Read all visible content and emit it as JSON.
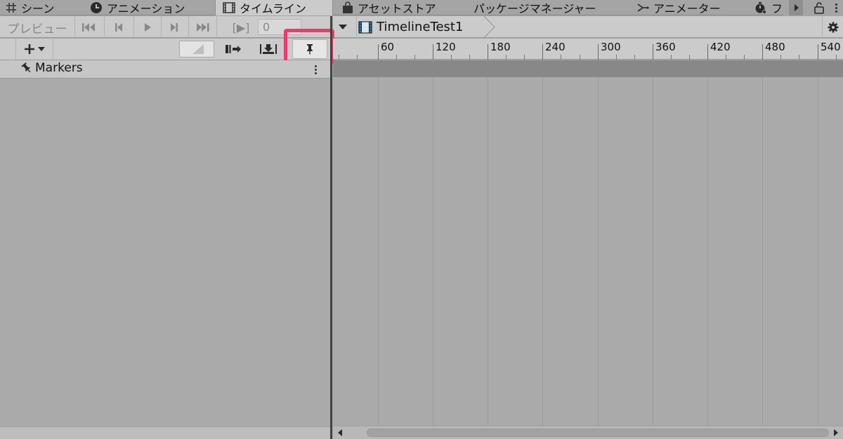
{
  "tabs": [
    {
      "label": "シーン",
      "icon": "grid-icon"
    },
    {
      "label": "アニメーション",
      "icon": "clock-icon"
    },
    {
      "label": "タイムライン",
      "icon": "film-icon",
      "active": true
    },
    {
      "label": "アセットストア",
      "icon": "shopping-bag-icon"
    },
    {
      "label": "パッケージマネージャー",
      "icon": "none"
    },
    {
      "label": "アニメーター",
      "icon": "animator-icon"
    },
    {
      "label": "フ",
      "icon": "profiler-icon"
    }
  ],
  "toolbar": {
    "preview_label": "プレビュー",
    "frame_value": "0",
    "play_range_label": "[▶]"
  },
  "breadcrumb": {
    "timeline_name": "TimelineTest1"
  },
  "ruler": {
    "labels": [
      "60",
      "120",
      "180",
      "240",
      "300",
      "360",
      "420",
      "480",
      "540"
    ]
  },
  "tracks": [
    {
      "label": "Markers",
      "icon": "pin-icon"
    }
  ],
  "colors": {
    "highlight": "#ee3a6c",
    "panel": "#cbcbcb",
    "background": "#aaaaaa",
    "marker_lane": "#888888"
  }
}
